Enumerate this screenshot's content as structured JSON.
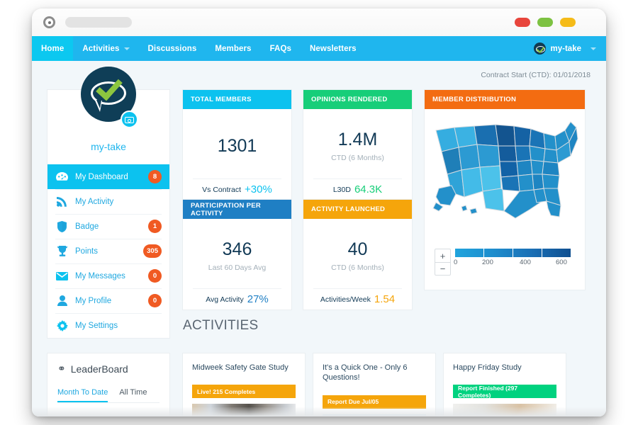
{
  "browser": {
    "logo_icon": "target-circle-icon",
    "address_placeholder": "",
    "window_buttons": [
      "close",
      "minimize",
      "maximize"
    ]
  },
  "nav": {
    "items": [
      {
        "label": "Home",
        "active": true,
        "has_caret": false
      },
      {
        "label": "Activities",
        "active": false,
        "has_caret": true
      },
      {
        "label": "Discussions",
        "active": false,
        "has_caret": false
      },
      {
        "label": "Members",
        "active": false,
        "has_caret": false
      },
      {
        "label": "FAQs",
        "active": false,
        "has_caret": false
      },
      {
        "label": "Newsletters",
        "active": false,
        "has_caret": false
      }
    ],
    "user": "my-take"
  },
  "header": {
    "contract_start": "Contract Start (CTD): 01/01/2018"
  },
  "sidebar": {
    "username": "my-take",
    "avatar_icon": "speech-bubble-check-logo",
    "camera_icon": "camera-icon",
    "items": [
      {
        "label": "My Dashboard",
        "icon": "dashboard-gauge-icon",
        "badge": "8",
        "active": true
      },
      {
        "label": "My Activity",
        "icon": "rss-feed-icon",
        "badge": "",
        "active": false
      },
      {
        "label": "Badge",
        "icon": "shield-icon",
        "badge": "1",
        "active": false
      },
      {
        "label": "Points",
        "icon": "trophy-icon",
        "badge": "305",
        "active": false
      },
      {
        "label": "My Messages",
        "icon": "envelope-icon",
        "badge": "0",
        "active": false
      },
      {
        "label": "My Profile",
        "icon": "user-icon",
        "badge": "0",
        "active": false
      },
      {
        "label": "My Settings",
        "icon": "gear-icon",
        "badge": "",
        "active": false
      }
    ]
  },
  "kpis": [
    {
      "title": "TOTAL MEMBERS",
      "header_color": "#0cc2ef",
      "value": "1301",
      "sub": "",
      "foot_label": "Vs Contract",
      "foot_value": "+30%",
      "foot_color": "#0cc2ef"
    },
    {
      "title": "OPINIONS RENDERED",
      "header_color": "#17ce79",
      "value": "1.4M",
      "sub": "CTD (6 Months)",
      "foot_label": "L30D",
      "foot_value": "64.3K",
      "foot_color": "#17ce79"
    },
    {
      "title": "PARTICIPATION PER ACTIVITY",
      "header_color": "#1f7fc4",
      "value": "346",
      "sub": "Last 60 Days Avg",
      "foot_label": "Avg Activity",
      "foot_value": "27%",
      "foot_color": "#1f7fc4"
    },
    {
      "title": "ACTIVITY LAUNCHED",
      "header_color": "#f5a50b",
      "value": "40",
      "sub": "CTD (6 Months)",
      "foot_label": "Activities/Week",
      "foot_value": "1.54",
      "foot_color": "#f5a50b"
    }
  ],
  "map": {
    "title": "MEMBER DISTRIBUTION",
    "zoom_in_label": "+",
    "zoom_out_label": "−",
    "legend_ticks": [
      "0",
      "200",
      "400",
      "600"
    ]
  },
  "chart_data": {
    "type": "heatmap",
    "title": "MEMBER DISTRIBUTION",
    "subtype": "choropleth-us-states",
    "colorbar": {
      "ticks": [
        0,
        200,
        400,
        600
      ],
      "range": [
        0,
        600
      ],
      "colors": [
        "#20a4dd",
        "#1e8dcd",
        "#1a6fb5",
        "#0f4f90"
      ]
    },
    "legend_position": "bottom",
    "notes": "US state-level member counts shaded from light blue (low) to dark navy (high)"
  },
  "activities": {
    "section_title": "ACTIVITIES",
    "leaderboard": {
      "title": "LeaderBoard",
      "icon": "ribbon-award-icon",
      "tabs": [
        {
          "label": "Month To Date",
          "active": true
        },
        {
          "label": "All Time",
          "active": false
        }
      ]
    },
    "cards": [
      {
        "title": "Midweek Safety Gate Study",
        "status": "Live! 215 Completes",
        "status_color": "#f5a50b",
        "thumb": "thumb-1"
      },
      {
        "title": "It's a Quick One - Only 6 Questions!",
        "status": "Report Due Jul/05",
        "status_color": "#f5a50b",
        "thumb": "thumb-2"
      },
      {
        "title": "Happy Friday Study",
        "status": "Report Finished (297 Completes)",
        "status_color": "#00d27f",
        "thumb": "thumb-3"
      }
    ]
  }
}
